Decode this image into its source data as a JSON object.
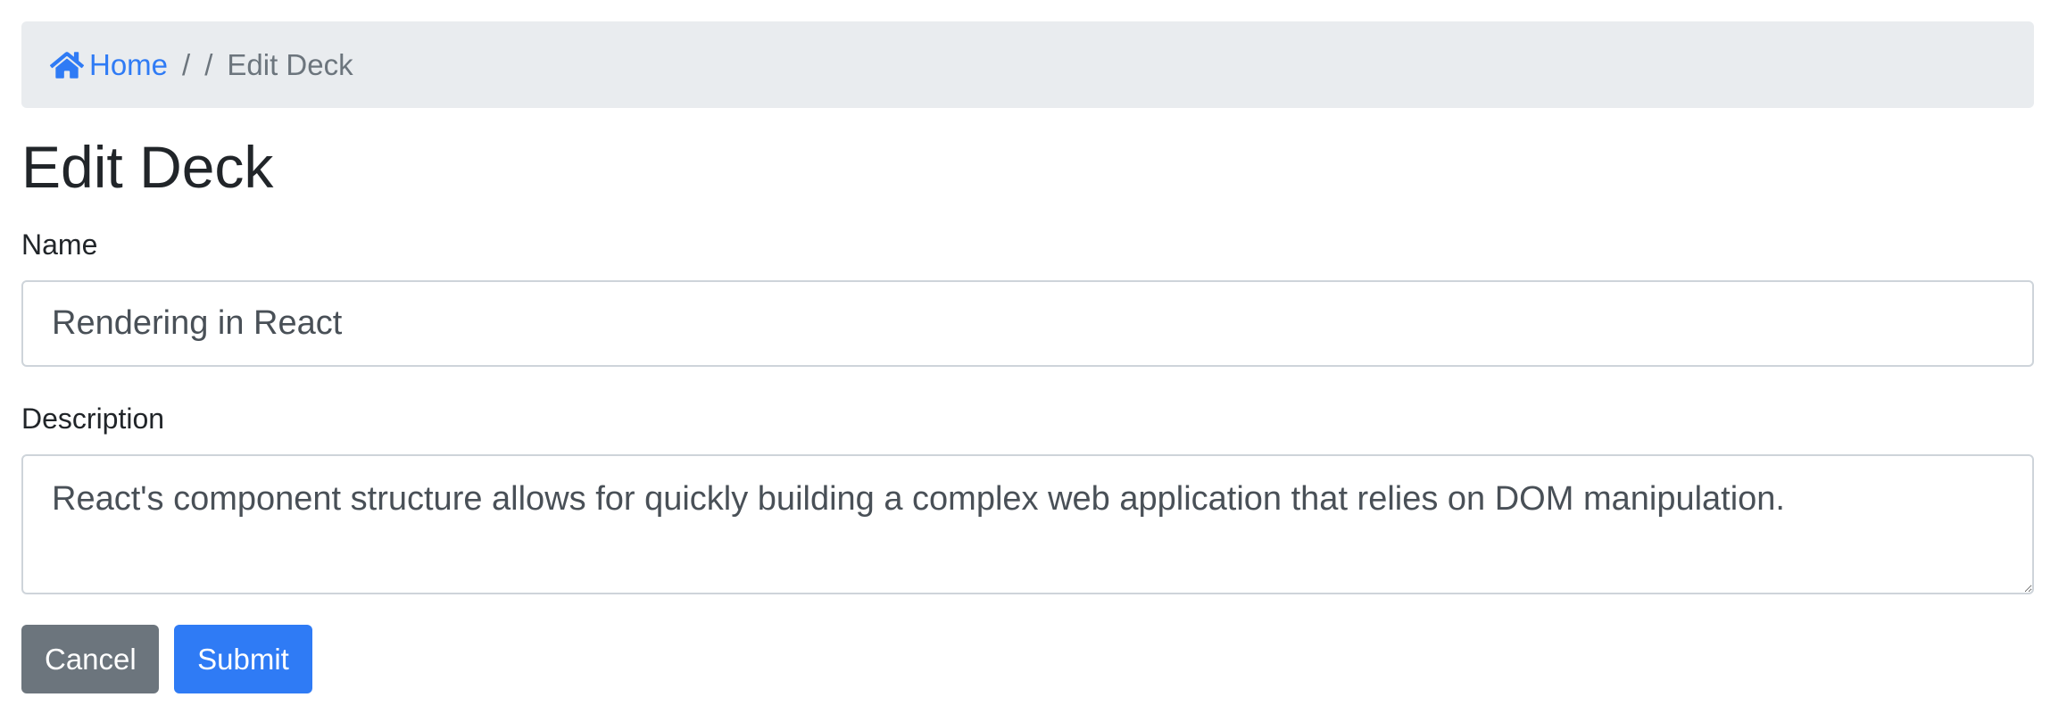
{
  "breadcrumb": {
    "home_label": "Home",
    "separator": "/",
    "middle_label": "",
    "active_label": "Edit Deck"
  },
  "page": {
    "title": "Edit Deck"
  },
  "form": {
    "name_label": "Name",
    "name_value": "Rendering in React",
    "description_label": "Description",
    "description_value": "React's component structure allows for quickly building a complex web application that relies on DOM manipulation."
  },
  "buttons": {
    "cancel_label": "Cancel",
    "submit_label": "Submit"
  },
  "colors": {
    "primary": "#2f7bf5",
    "secondary": "#6c757d",
    "breadcrumb_bg": "#e9ecef"
  },
  "icons": {
    "home": "home-icon"
  }
}
